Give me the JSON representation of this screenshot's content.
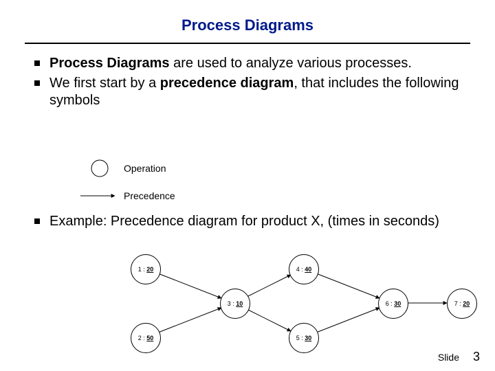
{
  "title": "Process Diagrams",
  "bullets": {
    "b1_bold": "Process Diagrams",
    "b1_rest": " are used to analyze various processes.",
    "b2_pre": "We first start by a ",
    "b2_bold": "precedence diagram",
    "b2_post": ", that includes the following symbols"
  },
  "legend": {
    "operation_label": "Operation",
    "precedence_label": "Precedence"
  },
  "bullets2": {
    "b3": "Example: Precedence diagram for product X, (times in seconds)"
  },
  "chart_data": {
    "type": "diagram",
    "description": "precedence diagram",
    "nodes": [
      {
        "id": "1",
        "time": 20
      },
      {
        "id": "2",
        "time": 50
      },
      {
        "id": "3",
        "time": 10
      },
      {
        "id": "4",
        "time": 40
      },
      {
        "id": "5",
        "time": 30
      },
      {
        "id": "6",
        "time": 30
      },
      {
        "id": "7",
        "time": 20
      }
    ],
    "edges": [
      [
        "1",
        "3"
      ],
      [
        "2",
        "3"
      ],
      [
        "3",
        "4"
      ],
      [
        "3",
        "5"
      ],
      [
        "4",
        "6"
      ],
      [
        "5",
        "6"
      ],
      [
        "6",
        "7"
      ]
    ],
    "units": "seconds"
  },
  "nodes": {
    "n1_id": "1 :",
    "n1_t": "20",
    "n2_id": "2 :",
    "n2_t": "50",
    "n3_id": "3 :",
    "n3_t": "10",
    "n4_id": "4 :",
    "n4_t": "40",
    "n5_id": "5 :",
    "n5_t": "30",
    "n6_id": "6 :",
    "n6_t": "30",
    "n7_id": "7 :",
    "n7_t": "20"
  },
  "footer": {
    "slide_label": "Slide",
    "page_number": "3"
  }
}
